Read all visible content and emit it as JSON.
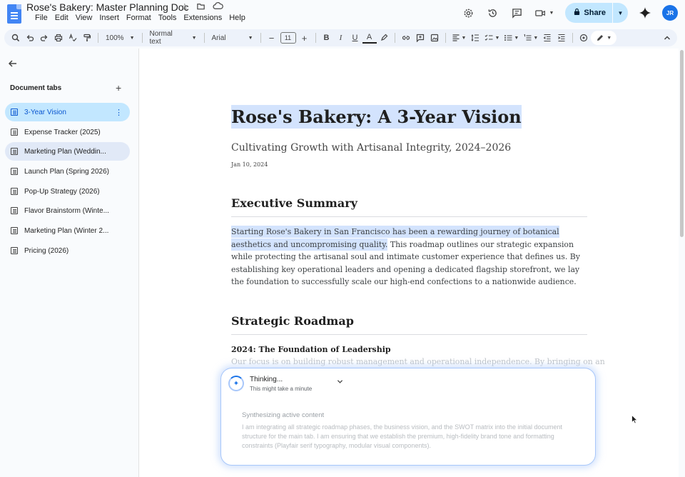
{
  "window": {
    "doc_title": "Rose's Bakery: Master Planning Doc",
    "menu": [
      "File",
      "Edit",
      "View",
      "Insert",
      "Format",
      "Tools",
      "Extensions",
      "Help"
    ],
    "share_label": "Share",
    "avatar_initials": "JR"
  },
  "toolbar": {
    "zoom": "100%",
    "style": "Normal text",
    "font": "Arial",
    "font_size": "11"
  },
  "sidebar": {
    "header": "Document tabs",
    "tabs": [
      {
        "label": "3-Year Vision"
      },
      {
        "label": "Expense Tracker (2025)"
      },
      {
        "label": "Marketing Plan (Weddin..."
      },
      {
        "label": "Launch Plan (Spring 2026)"
      },
      {
        "label": "Pop-Up Strategy (2026)"
      },
      {
        "label": "Flavor Brainstorm (Winte..."
      },
      {
        "label": "Marketing Plan (Winter 2..."
      },
      {
        "label": "Pricing (2026)"
      }
    ]
  },
  "document": {
    "title": "Rose's Bakery: A 3-Year Vision",
    "subtitle": "Cultivating Growth with Artisanal Integrity, 2024–2026",
    "date": "Jan 10, 2024",
    "section1_heading": "Executive Summary",
    "section1_highlight": "Starting Rose's Bakery in San Francisco has been a rewarding journey of botanical aesthetics and uncompromising quality.",
    "section1_rest": " This roadmap outlines our strategic expansion while protecting the artisanal soul and intimate customer experience that defines us. By establishing key operational leaders and opening a dedicated flagship storefront, we lay the foundation to successfully scale our high-end confections to a nationwide audience.",
    "section2_heading": "Strategic Roadmap",
    "subsection_heading": "2024: The Foundation of Leadership",
    "faded_line": "Our focus is on building robust management and operational independence. By bringing on an"
  },
  "thinking": {
    "title": "Thinking...",
    "subtitle": "This might take a minute",
    "step_title": "Synthesizing active content",
    "step_body": "I am integrating all strategic roadmap phases, the business vision, and the SWOT matrix into the initial document structure for the main tab. I am ensuring that we establish the premium, high-fidelity brand tone and formatting constraints (Playfair serif typography, modular visual components)."
  }
}
